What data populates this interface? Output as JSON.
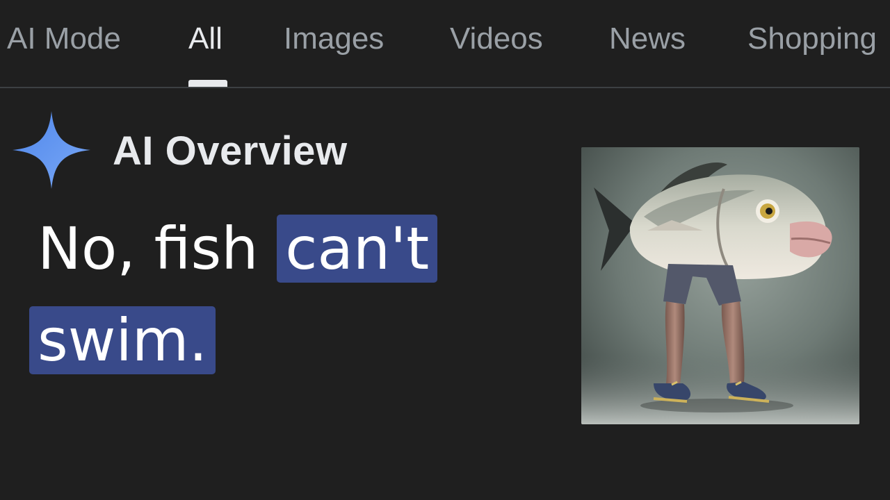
{
  "tabs": [
    {
      "label": "AI Mode",
      "active": false
    },
    {
      "label": "All",
      "active": true
    },
    {
      "label": "Images",
      "active": false
    },
    {
      "label": "Videos",
      "active": false
    },
    {
      "label": "News",
      "active": false
    },
    {
      "label": "Shopping",
      "active": false
    }
  ],
  "overview": {
    "title": "AI Overview",
    "icon": "sparkle-icon",
    "accent_color": "#669df6"
  },
  "answer": {
    "plain": "No, fish",
    "highlighted_1": "can't",
    "highlighted_2": "swim.",
    "highlight_color": "#394a8a"
  },
  "image": {
    "subject": "fish-with-human-legs-image"
  }
}
